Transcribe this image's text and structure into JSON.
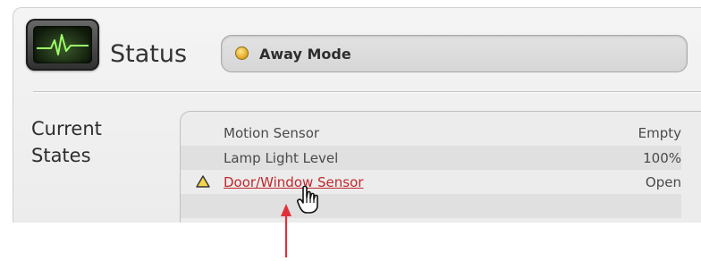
{
  "header": {
    "icon": "heartbeat-monitor-icon",
    "title": "Status",
    "mode": {
      "indicator_color": "#e8b42a",
      "label": "Away Mode"
    }
  },
  "current_states": {
    "label_line1": "Current",
    "label_line2": "States",
    "rows": [
      {
        "name": "Motion Sensor",
        "value": "Empty"
      },
      {
        "name": "Lamp Light Level",
        "value": "100%"
      },
      {
        "name": "Door/Window Sensor",
        "value": "Open",
        "warning_icon": "warning-triangle-icon",
        "link": true
      }
    ]
  },
  "annotation": {
    "arrow_color": "#e0303a"
  }
}
